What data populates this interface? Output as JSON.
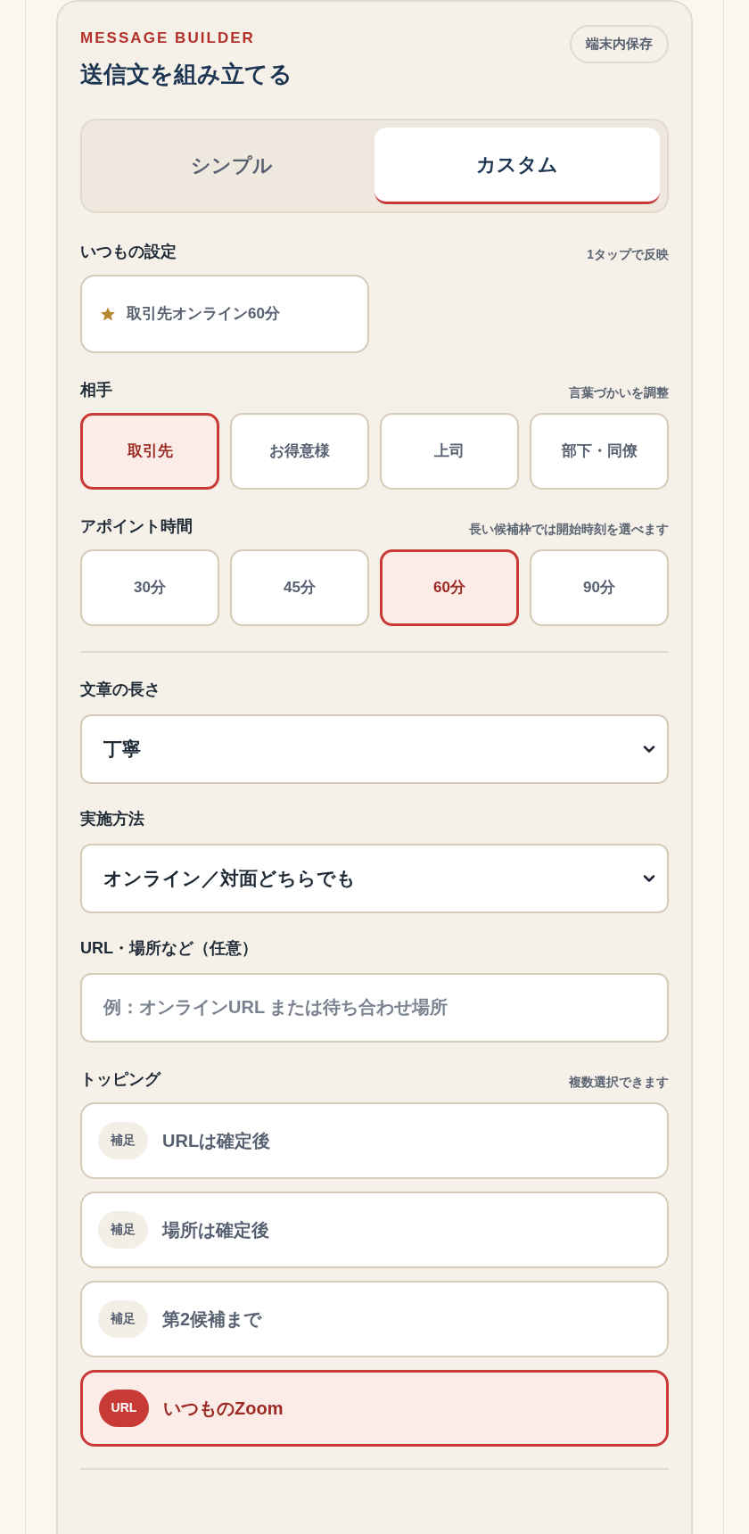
{
  "header": {
    "eyebrow": "MESSAGE BUILDER",
    "title": "送信文を組み立てる",
    "badge": "端末内保存"
  },
  "mode_tabs": [
    {
      "label": "シンプル",
      "selected": false
    },
    {
      "label": "カスタム",
      "selected": true
    }
  ],
  "presets": {
    "label": "いつもの設定",
    "hint": "1タップで反映",
    "items": [
      {
        "label": "取引先オンライン60分"
      }
    ]
  },
  "recipient": {
    "label": "相手",
    "hint": "言葉づかいを調整",
    "options": [
      {
        "label": "取引先",
        "selected": true
      },
      {
        "label": "お得意様",
        "selected": false
      },
      {
        "label": "上司",
        "selected": false
      },
      {
        "label": "部下・同僚",
        "selected": false
      }
    ]
  },
  "duration": {
    "label": "アポイント時間",
    "hint": "長い候補枠では開始時刻を選べます",
    "options": [
      {
        "label": "30分",
        "selected": false
      },
      {
        "label": "45分",
        "selected": false
      },
      {
        "label": "60分",
        "selected": true
      },
      {
        "label": "90分",
        "selected": false
      }
    ]
  },
  "length": {
    "label": "文章の長さ",
    "value": "丁寧"
  },
  "method": {
    "label": "実施方法",
    "value": "オンライン／対面どちらでも"
  },
  "location": {
    "label": "URL・場所など（任意）",
    "placeholder": "例：オンラインURL または待ち合わせ場所"
  },
  "toppings": {
    "label": "トッピング",
    "hint": "複数選択できます",
    "items": [
      {
        "kind": "note",
        "tag": "補足",
        "label": "URLは確定後",
        "selected": false
      },
      {
        "kind": "note",
        "tag": "補足",
        "label": "場所は確定後",
        "selected": false
      },
      {
        "kind": "note",
        "tag": "補足",
        "label": "第2候補まで",
        "selected": false
      },
      {
        "kind": "url",
        "tag": "URL",
        "label": "いつものZoom",
        "selected": true
      }
    ]
  }
}
